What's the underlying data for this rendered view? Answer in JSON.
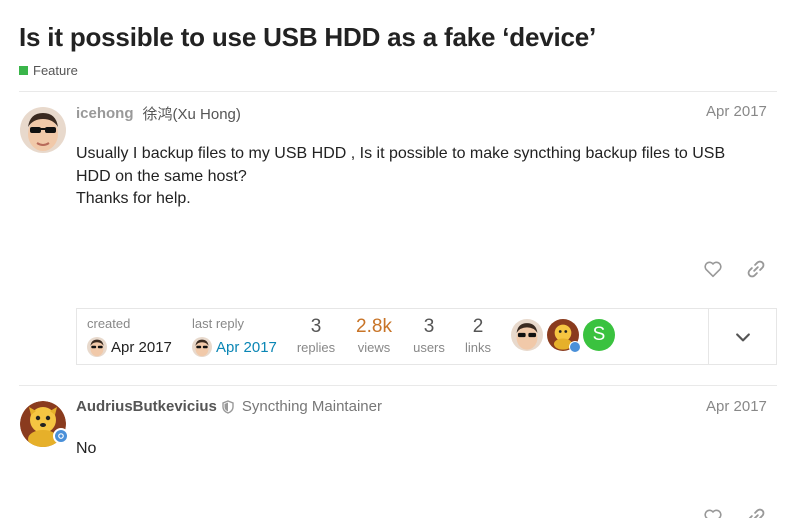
{
  "topic": {
    "title": "Is it possible to use USB HDD as a fake ‘device’",
    "category": "Feature",
    "category_color": "#3ab54a"
  },
  "posts": [
    {
      "username": "icehong",
      "full_name": "徐鸿(Xu Hong)",
      "date": "Apr 2017",
      "body_lines": [
        "Usually I backup files to my USB HDD , Is it possible to make syncthing backup files to USB",
        "HDD on the same host?",
        "Thanks for help."
      ],
      "avatar_icon": "user-avatar-sunglasses"
    },
    {
      "username": "AudriusButkevicius",
      "user_title": "Syncthing Maintainer",
      "date": "Apr 2017",
      "body_lines": [
        "No"
      ],
      "avatar_icon": "user-avatar-cartoon-dog"
    }
  ],
  "topic_map": {
    "created_label": "created",
    "created_date": "Apr 2017",
    "last_reply_label": "last reply",
    "last_reply_date": "Apr 2017",
    "stats": [
      {
        "value": "3",
        "label": "replies"
      },
      {
        "value": "2.8k",
        "label": "views"
      },
      {
        "value": "3",
        "label": "users"
      },
      {
        "value": "2",
        "label": "links"
      }
    ],
    "participant_letter": "S",
    "link_color": "#0a86b5",
    "hot_color": "#c87427"
  }
}
